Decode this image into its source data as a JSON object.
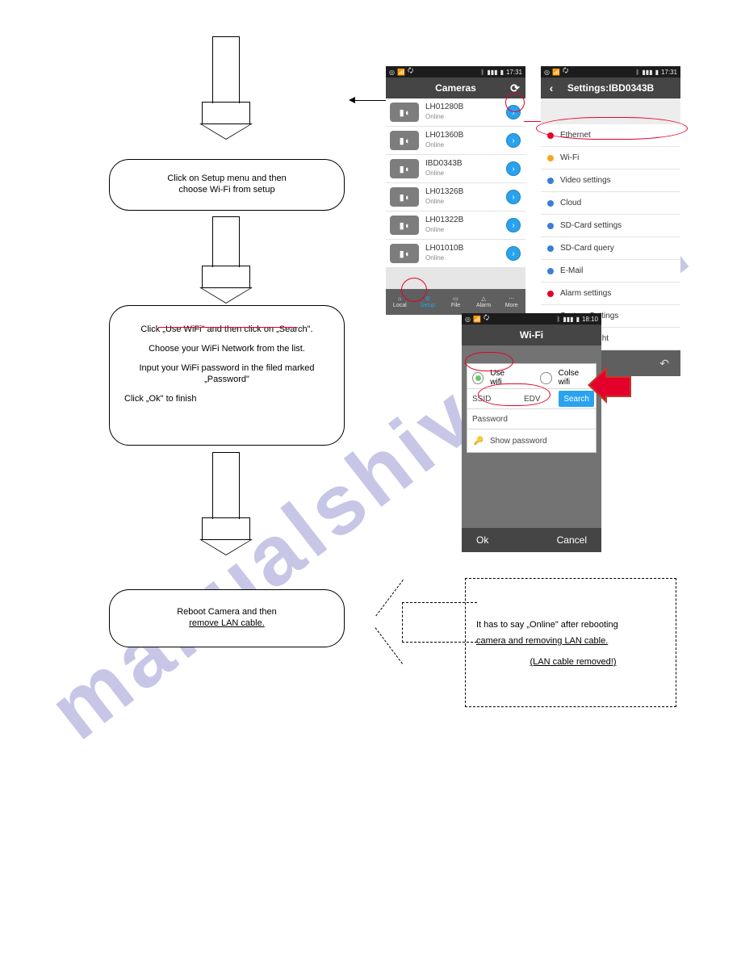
{
  "watermark": "manualshive   com",
  "flow": {
    "box1_line1": "Click on Setup menu and then",
    "box1_line2": "choose Wi-Fi from setup",
    "box2_line1": "Click „Use WiFi\" and then click on „Search\".",
    "box2_line2": "Choose your WiFi Network from the list.",
    "box2_line3": "Input your WiFi password in the filed marked",
    "box2_line4": "„Password\"",
    "box2_line5": "Click „Ok\" to finish",
    "box3_line1": "Reboot Camera and then",
    "box3_line2": "remove LAN cable.",
    "dashed_line1": "It has to say „Online\" after rebooting",
    "dashed_line2": "camera and removing LAN cable.",
    "dashed_line3": "(LAN cable removed!)"
  },
  "status": {
    "time1": "17:31",
    "time2": "18:10"
  },
  "cameras": {
    "title": "Cameras",
    "items": [
      {
        "name": "LH01280B",
        "status": "Online"
      },
      {
        "name": "LH01360B",
        "status": "Online"
      },
      {
        "name": "IBD0343B",
        "status": "Online"
      },
      {
        "name": "LH01326B",
        "status": "Online"
      },
      {
        "name": "LH01322B",
        "status": "Online"
      },
      {
        "name": "LH01010B",
        "status": "Online"
      }
    ],
    "tabs": [
      "Local",
      "Setup",
      "File",
      "Alarm",
      "More"
    ]
  },
  "settings": {
    "title": "Settings:IBD0343B",
    "items": [
      {
        "label": "Ethernet",
        "color": "#e4002b"
      },
      {
        "label": "Wi-Fi",
        "color": "#f5a623"
      },
      {
        "label": "Video settings",
        "color": "#3b7dd8"
      },
      {
        "label": "Cloud",
        "color": "#3b7dd8"
      },
      {
        "label": "SD-Card settings",
        "color": "#3b7dd8"
      },
      {
        "label": "SD-Card query",
        "color": "#3b7dd8"
      },
      {
        "label": "E-Mail",
        "color": "#3b7dd8"
      },
      {
        "label": "Alarm settings",
        "color": "#e4002b"
      },
      {
        "label": "System Settings",
        "color": "#3b7dd8"
      },
      {
        "label": "Camera Light",
        "color": "#f5c518"
      }
    ]
  },
  "wifi": {
    "title": "Wi-Fi",
    "use": "Use wifi",
    "close": "Colse wifi",
    "ssid_label": "SSID",
    "ssid_value": "EDV",
    "password_label": "Password",
    "search": "Search",
    "show": "Show password",
    "ok": "Ok",
    "cancel": "Cancel"
  }
}
